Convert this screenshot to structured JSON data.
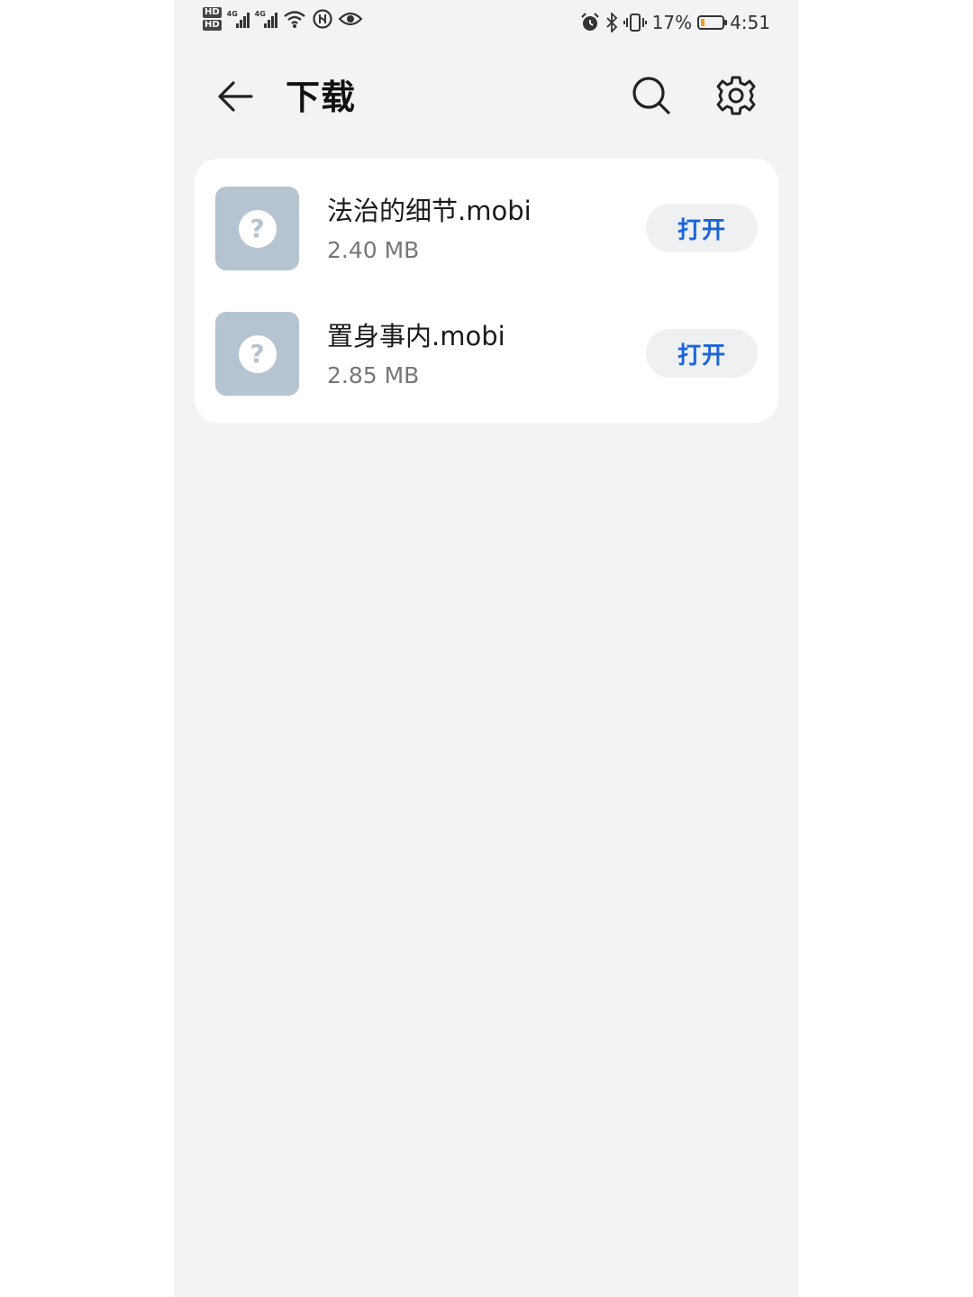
{
  "status_bar": {
    "hd1": "HD",
    "hd2": "HD",
    "net1": "4G",
    "net2": "4G",
    "battery_percent": "17%",
    "battery_level": 0.17,
    "time": "4:51",
    "icons": [
      "wifi-icon",
      "nfc-icon",
      "eye-icon",
      "alarm-icon",
      "bluetooth-icon",
      "vibrate-icon"
    ]
  },
  "header": {
    "title": "下载"
  },
  "files": [
    {
      "name": "法治的细节.mobi",
      "size": "2.40 MB",
      "action": "打开",
      "icon_glyph": "?"
    },
    {
      "name": "置身事内.mobi",
      "size": "2.85 MB",
      "action": "打开",
      "icon_glyph": "?"
    }
  ],
  "colors": {
    "accent": "#1c64d6",
    "file_icon_bg": "#b5c4d0",
    "background": "#f1f3f5",
    "battery_fill": "#f39a1c"
  }
}
